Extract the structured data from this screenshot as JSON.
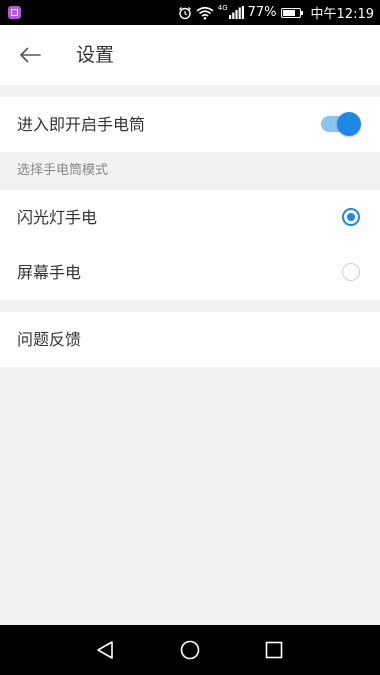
{
  "status_bar": {
    "app_icon": "gallery-app-icon",
    "network_label": "4G",
    "battery_level": "77%",
    "battery_fraction": 0.77,
    "time": "中午12:19",
    "icons": [
      "alarm-icon",
      "wifi-icon",
      "signal-icon",
      "battery-icon"
    ]
  },
  "app_bar": {
    "back_icon": "arrow-left-icon",
    "title": "设置"
  },
  "settings": {
    "auto_on": {
      "label": "进入即开启手电筒",
      "enabled": true
    },
    "mode_section": {
      "header": "选择手电筒模式",
      "options": [
        {
          "label": "闪光灯手电",
          "selected": true
        },
        {
          "label": "屏幕手电",
          "selected": false
        }
      ]
    },
    "feedback": {
      "label": "问题反馈"
    }
  },
  "nav_bar": {
    "icons": [
      "back-triangle-icon",
      "home-circle-icon",
      "recents-square-icon"
    ]
  },
  "colors": {
    "accent": "#1e88e5",
    "accent_light": "#8fc4ec",
    "background": "#f2f2f2",
    "surface": "#ffffff",
    "text_primary": "#333333",
    "text_secondary": "#888888"
  }
}
